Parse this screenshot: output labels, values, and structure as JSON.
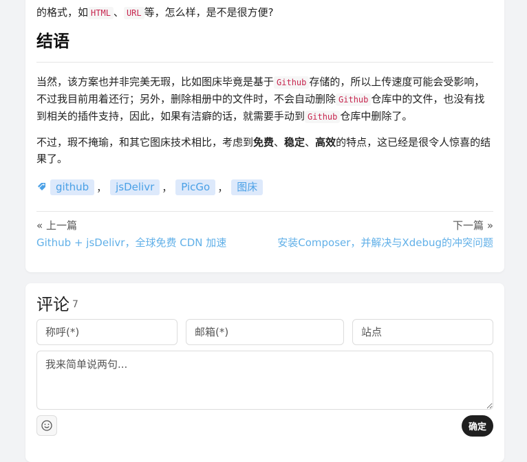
{
  "article": {
    "intro": {
      "before": "的格式，如",
      "code1": "HTML",
      "mid": "、",
      "code2": "URL",
      "after": "等，怎么样，是不是很方便?"
    },
    "heading": "结语",
    "p1": {
      "t1": "当然，该方案也并非完美无瑕，比如图床毕竟是基于",
      "c1": "Github",
      "t2": "存储的，所以上传速度可能会受影响，不过我目前用着还行；另外，删除相册中的文件时，不会自动删除",
      "c2": "Github",
      "t3": "仓库中的文件，也没有找到相关的插件支持，因此，如果有洁癖的话，就需要手动到",
      "c3": "Github",
      "t4": "仓库中删除了。"
    },
    "p2": {
      "t1": "不过，瑕不掩瑜，和其它图床技术相比，考虑到",
      "b1": "免费",
      "t2": "、",
      "b2": "稳定",
      "t3": "、",
      "b3": "高效",
      "t4": "的特点，这已经是很令人惊喜的结果了。"
    },
    "tags": [
      "github",
      "jsDelivr",
      "PicGo",
      "图床"
    ],
    "tag_separator": "，",
    "nav": {
      "prev_label": "« 上一篇",
      "prev_title": "Github + jsDelivr，全球免费 CDN 加速",
      "next_label": "下一篇 »",
      "next_title": "安装Composer，并解决与Xdebug的冲突问题"
    }
  },
  "comments": {
    "title": "评论",
    "count": "7",
    "name_placeholder": "称呼(*)",
    "email_placeholder": "邮箱(*)",
    "site_placeholder": "站点",
    "content_placeholder": "我来简单说两句...",
    "submit_label": "确定"
  },
  "colors": {
    "link": "#61b0e8",
    "tag_bg": "#dde9fb",
    "tag_text": "#4aa0e6",
    "code_text": "#c7254e",
    "button_bg": "#1f1f1f",
    "page_bg": "#f2f3f5"
  },
  "icons": {
    "tag": "tag-icon",
    "emoji": "smile-icon"
  }
}
